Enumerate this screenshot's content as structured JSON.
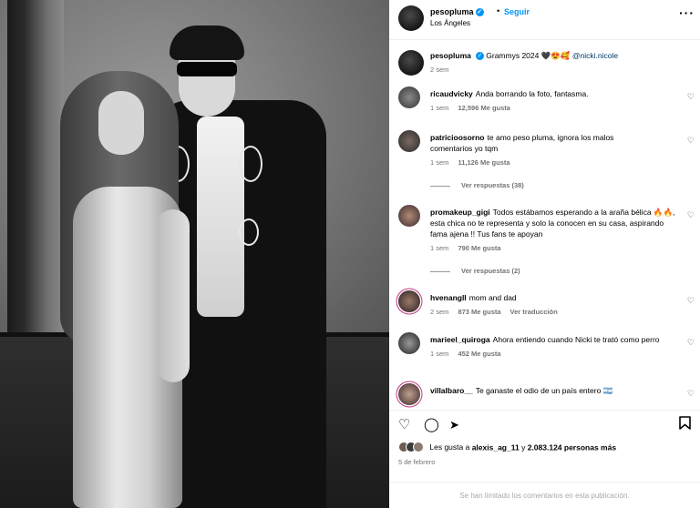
{
  "post_header": {
    "username": "pesopluma",
    "separator": "•",
    "follow_label": "Seguir",
    "location": "Los Ángeles",
    "more_label": "···"
  },
  "caption": {
    "username": "pesopluma",
    "text": "Grammys 2024 🖤😍🥰",
    "mention": "@nicki.nicole",
    "time": "2 sem"
  },
  "comments": [
    {
      "username": "ricaudvicky",
      "text": "Anda borrando la foto, fantasma.",
      "time": "1 sem",
      "likes": "12,596 Me gusta"
    },
    {
      "username": "patricioosorno",
      "text": "te amo peso pluma, ignora los malos comentarios yo tqm",
      "time": "1 sem",
      "likes": "11,126 Me gusta",
      "replies": "Ver respuestas (38)"
    },
    {
      "username": "promakeup_gigi",
      "text": "Todos estábamos esperando a la araña bélica 🔥🔥, esta chica no te representa y solo la conocen en su casa, aspirando fama ajena !! Tus fans te apoyan",
      "time": "1 sem",
      "likes": "790 Me gusta",
      "replies": "Ver respuestas (2)"
    },
    {
      "username": "hvenangll",
      "text": "mom and dad",
      "time": "2 sem",
      "likes": "873 Me gusta",
      "translate": "Ver traducción"
    },
    {
      "username": "marieel_quiroga",
      "text": "Ahora entiendo cuando Nicki te trató como perro",
      "time": "1 sem",
      "likes": "452 Me gusta"
    },
    {
      "username": "villalbaro__",
      "text": "Te ganaste el odio de un país entero 🇦🇷",
      "time": "",
      "likes": ""
    }
  ],
  "actions": {
    "likes_prefix": "Les gusta a",
    "likes_user": "alexis_ag_11",
    "likes_middle": "y",
    "likes_count": "2.083.124 personas más",
    "date": "5 de febrero",
    "limited_text": "Se han limitado los comentarios en esta publicación."
  },
  "icons": {
    "heart": "♡",
    "comment": "◯",
    "share": "➤",
    "save": "🔖"
  },
  "colors": {
    "accent": "#0095f6",
    "meta": "#737373"
  }
}
